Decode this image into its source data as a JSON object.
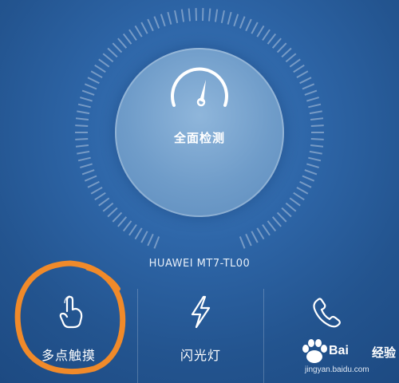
{
  "gauge": {
    "label": "全面检测",
    "icon": "speedometer-icon"
  },
  "device": {
    "name": "HUAWEI MT7-TL00"
  },
  "features": [
    {
      "label": "多点触摸",
      "icon": "touch-hand-icon"
    },
    {
      "label": "闪光灯",
      "icon": "lightning-icon"
    },
    {
      "label": "",
      "icon": "phone-icon"
    }
  ],
  "watermark": {
    "brand_a": "Bai",
    "brand_b": "经验",
    "url": "jingyan.baidu.com"
  },
  "colors": {
    "background": "#2a5d9d",
    "highlight": "#f08a2a",
    "text": "#ffffff"
  }
}
